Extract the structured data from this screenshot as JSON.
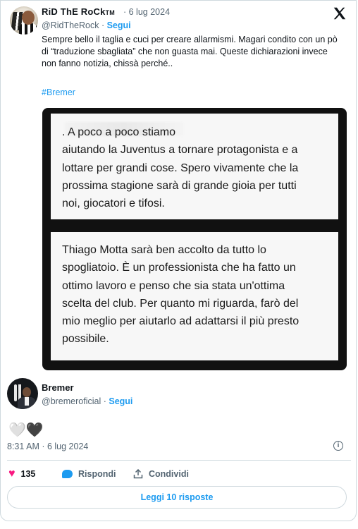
{
  "tweet": {
    "author": {
      "name": "RiD ThE RoCk",
      "name_suffix": "TM",
      "handle": "@RidTheRock",
      "follow_label": "Segui"
    },
    "date": "· 6 lug 2024",
    "text": "Sempre bello il taglia e cuci per creare allarmismi. Magari condito con un pò di “traduzione sbagliata” che non guasta mai. Queste dichiarazioni invece non fanno notizia, chissà perché..",
    "hashtag": "#Bremer",
    "image": {
      "panel1_text": ". A poco a poco stiamo\naiutando la Juventus a tornare protagonista e a\nlottare per grandi cose. Spero vivamente che la\nprossima stagione sarà di grande gioia per tutti\nnoi, giocatori e tifosi.",
      "panel2_text": "Thiago Motta sarà ben accolto da tutto lo\nspogliatoio. È un professionista che ha fatto un\nottimo lavoro e penso che sia stata un'ottima\nscelta del club. Per quanto mi riguarda, farò del\nmio meglio per aiutarlo ad adattarsi il più presto\npossibile."
    }
  },
  "quoted": {
    "name": "Bremer",
    "handle": "@bremeroficial ·",
    "follow_label": "Segui",
    "hearts": [
      "🤍",
      "🖤"
    ]
  },
  "meta": {
    "timestamp": "8:31 AM · 6 lug 2024"
  },
  "actions": {
    "likes": "135",
    "reply_label": "Rispondi",
    "share_label": "Condividi"
  },
  "read_replies_label": "Leggi 10 risposte",
  "icons": {
    "x_logo": "x-logo-icon",
    "info": "info-icon",
    "like": "heart-icon",
    "reply": "reply-bubble-icon",
    "share": "share-icon"
  },
  "colors": {
    "accent": "#1d9bf0",
    "like": "#f91880",
    "muted": "#536471"
  }
}
